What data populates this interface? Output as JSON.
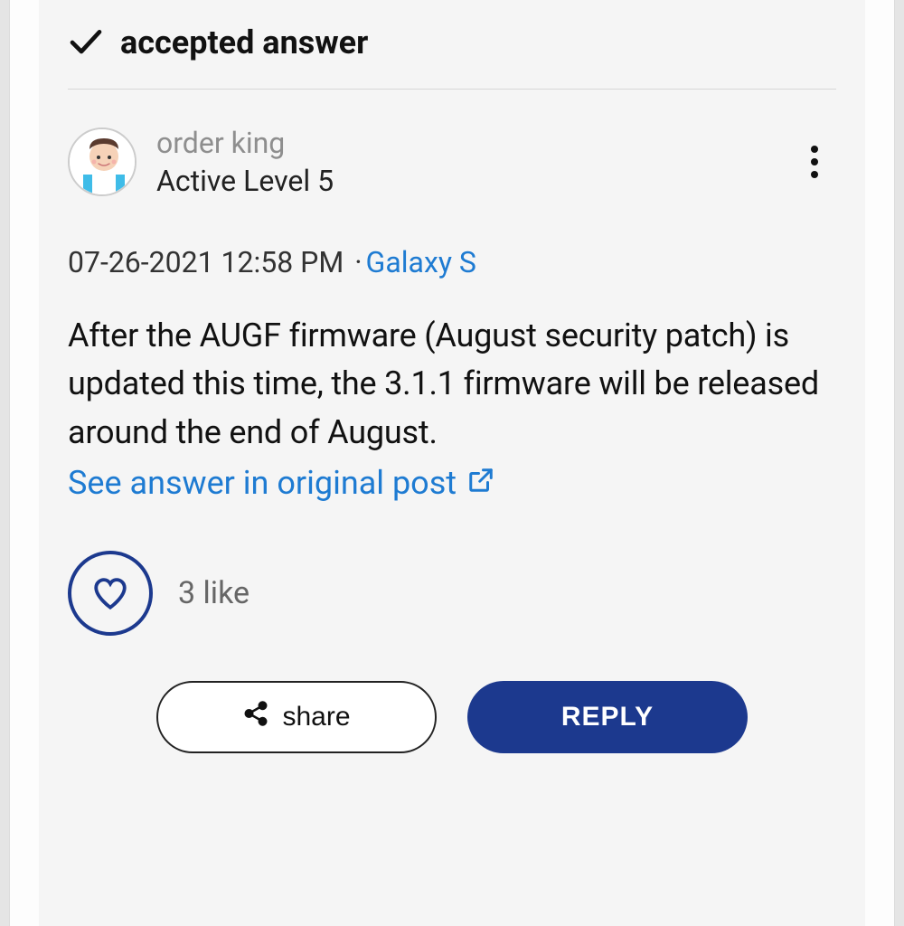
{
  "accepted_label": "accepted answer",
  "author": {
    "name": "order king",
    "level": "Active Level 5"
  },
  "meta": {
    "timestamp": "07-26-2021 12:58 PM",
    "category": "Galaxy S"
  },
  "body": "After the AUGF firmware (August security patch) is updated this time, the 3.1.1 firmware will be released around the end of August.",
  "see_answer_label": "See answer in original post",
  "likes": {
    "count_label": "3 like"
  },
  "actions": {
    "share": "share",
    "reply": "REPLY"
  }
}
